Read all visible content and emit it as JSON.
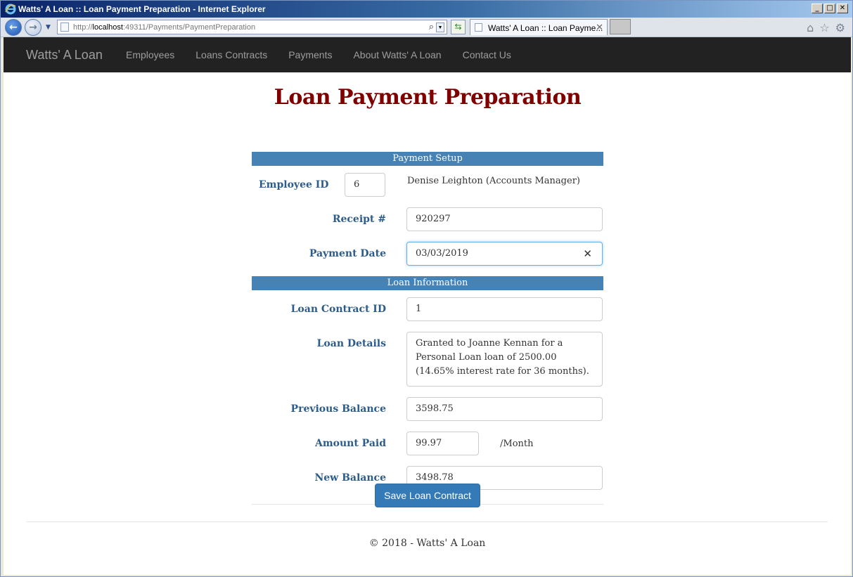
{
  "window": {
    "title": "Watts' A Loan :: Loan Payment Preparation - Internet Explorer",
    "minimize": "_",
    "maximize": "□",
    "close": "✕"
  },
  "browser": {
    "url_prefix": "http://",
    "url_host": "localhost",
    "url_rest": ":49311/Payments/PaymentPreparation",
    "tab_title": "Watts' A Loan :: Loan Payme...",
    "tab_close": "✕",
    "icons": [
      "home-icon",
      "favorites-star-icon",
      "tools-gear-icon"
    ]
  },
  "navbar": {
    "brand": "Watts' A Loan",
    "links": [
      "Employees",
      "Loans Contracts",
      "Payments",
      "About Watts' A Loan",
      "Contact Us"
    ]
  },
  "page": {
    "title": "Loan Payment Preparation",
    "payment_setup": {
      "header": "Payment Setup",
      "employee_id_label": "Employee ID",
      "employee_id_value": "6",
      "employee_name": "Denise Leighton (Accounts Manager)",
      "receipt_label": "Receipt #",
      "receipt_value": "920297",
      "payment_date_label": "Payment Date",
      "payment_date_value": "03/03/2019"
    },
    "loan_information": {
      "header": "Loan Information",
      "loan_contract_id_label": "Loan Contract ID",
      "loan_contract_id_value": "1",
      "loan_details_label": "Loan Details",
      "loan_details_value": "Granted to Joanne Kennan for a Personal Loan loan of 2500.00 (14.65% interest rate for 36 months).",
      "previous_balance_label": "Previous Balance",
      "previous_balance_value": "3598.75",
      "amount_paid_label": "Amount Paid",
      "amount_paid_value": "99.97",
      "amount_paid_suffix": "/Month",
      "new_balance_label": "New Balance",
      "new_balance_value": "3498.78"
    },
    "save_button": "Save Loan Contract",
    "footer": "© 2018 - Watts' A Loan"
  },
  "colors": {
    "title": "#800000",
    "section_bar": "#4682b4",
    "label": "#2c5c8a",
    "navbar_bg": "#222222",
    "primary_button": "#337ab7"
  }
}
